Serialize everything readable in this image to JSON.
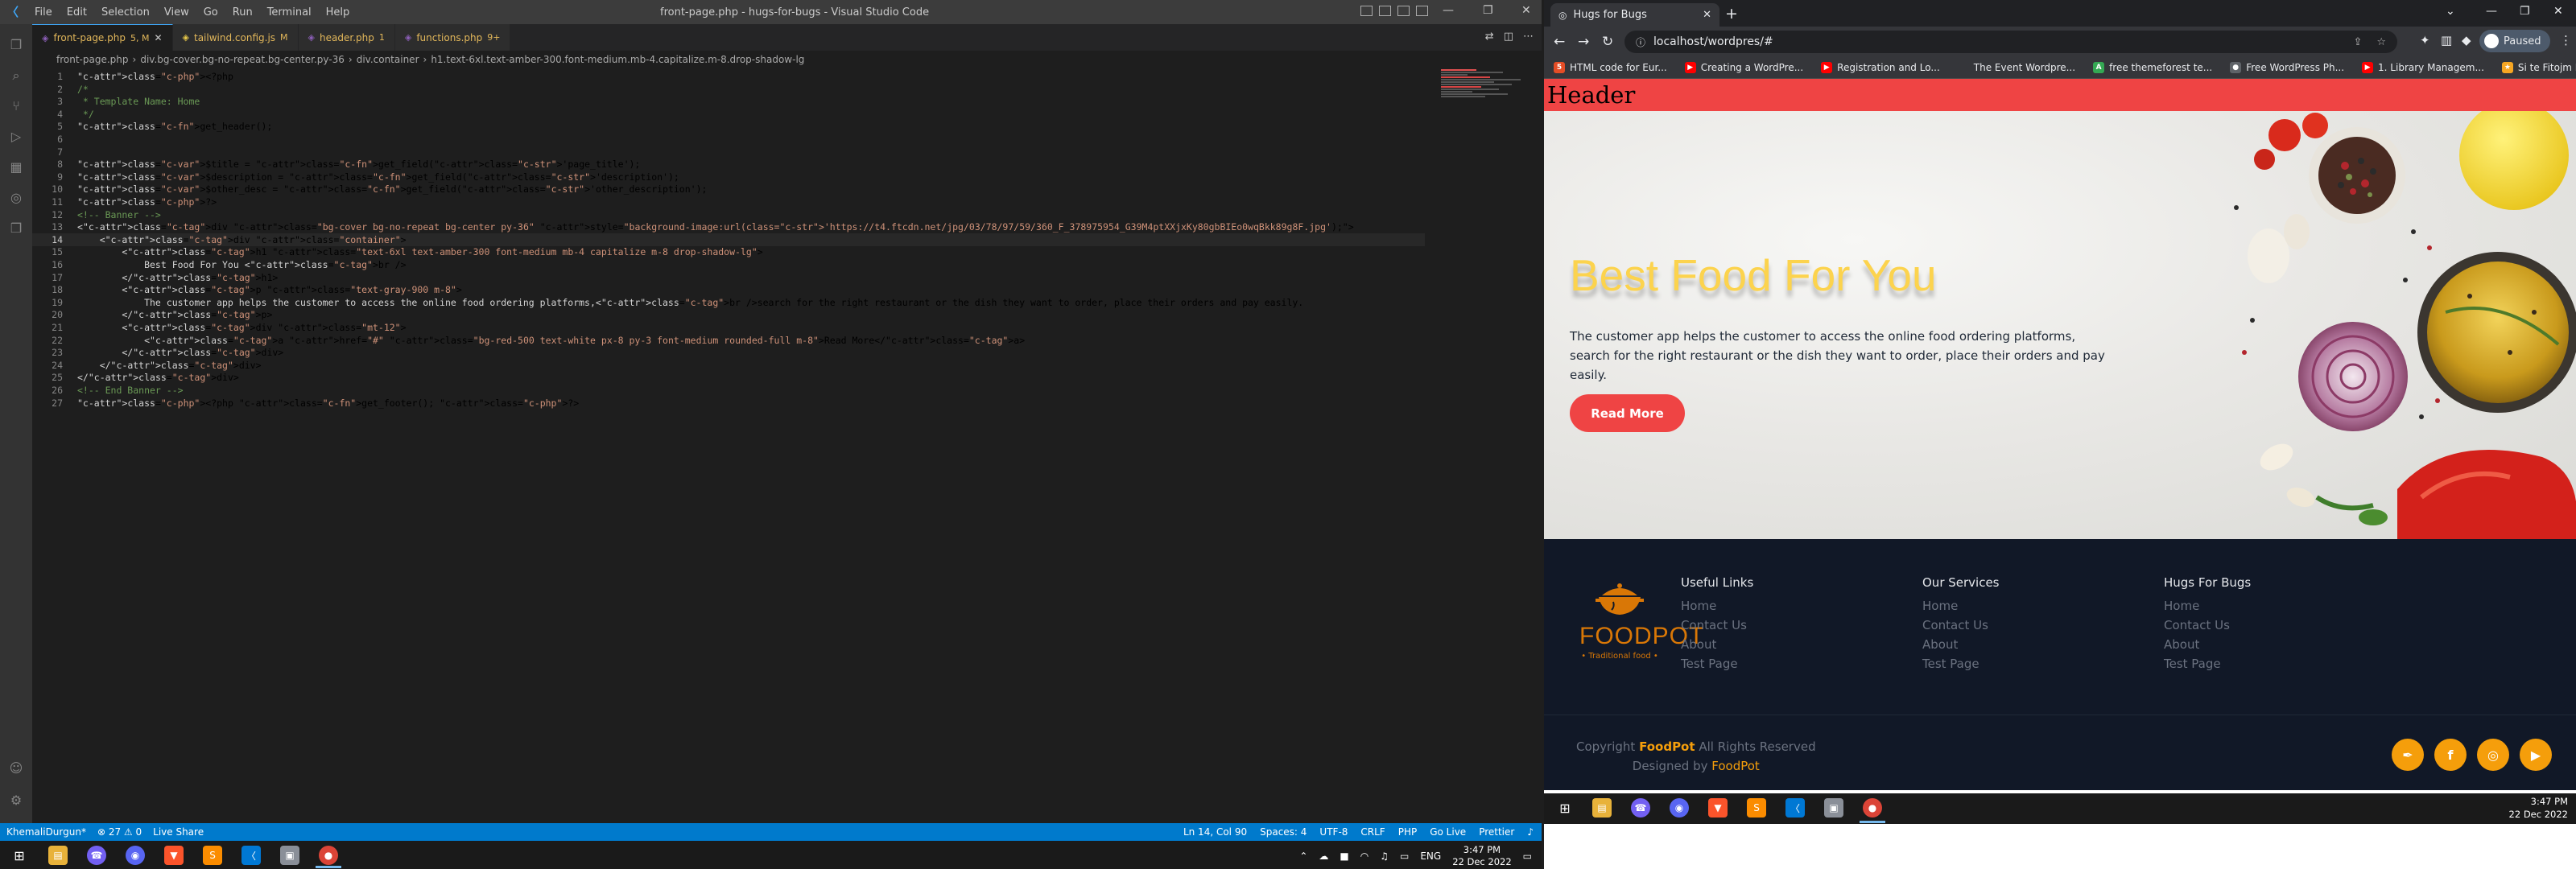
{
  "vscode": {
    "menu": [
      "File",
      "Edit",
      "Selection",
      "View",
      "Go",
      "Run",
      "Terminal",
      "Help"
    ],
    "window_title": "front-page.php - hugs-for-bugs - Visual Studio Code",
    "tabs": [
      {
        "label": "front-page.php",
        "suffix": "5, M",
        "active": true,
        "icon": "php"
      },
      {
        "label": "tailwind.config.js",
        "suffix": "M",
        "active": false,
        "icon": "js"
      },
      {
        "label": "header.php",
        "suffix": "1",
        "active": false,
        "icon": "php"
      },
      {
        "label": "functions.php",
        "suffix": "9+",
        "active": false,
        "icon": "php"
      }
    ],
    "breadcrumb": [
      "front-page.php",
      "div.bg-cover.bg-no-repeat.bg-center.py-36",
      "div.container",
      "h1.text-6xl.text-amber-300.font-medium.mb-4.capitalize.m-8.drop-shadow-lg"
    ],
    "code_lines": [
      "<?php",
      "/*",
      " * Template Name: Home",
      " */",
      "get_header();",
      "",
      "",
      "$title = get_field('page_title');",
      "$description = get_field('description');",
      "$other_desc = get_field('other_description');",
      "?>",
      "<!-- Banner -->",
      "<div class=\"bg-cover bg-no-repeat bg-center py-36\" style=\"background-image:url('https://t4.ftcdn.net/jpg/03/78/97/59/360_F_378975954_G39M4ptXXjxKy80gbBIEo0wqBkk89g8F.jpg');\">",
      "    <div class=\"container\">",
      "        <h1 class=\"text-6xl text-amber-300 font-medium mb-4 capitalize m-8 drop-shadow-lg\">",
      "            Best Food For You <br />",
      "        </h1>",
      "        <p class=\"text-gray-900 m-8\">",
      "            The customer app helps the customer to access the online food ordering platforms,<br />search for the right restaurant or the dish they want to order, place their orders and pay easily.",
      "        </p>",
      "        <div class=\"mt-12\">",
      "            <a href=\"#\" class=\"bg-red-500 text-white px-8 py-3 font-medium rounded-full m-8\">Read More</a>",
      "        </div>",
      "    </div>",
      "</div>",
      "<!-- End Banner -->",
      "<?php get_footer(); ?>"
    ],
    "status": {
      "branch": "KhemaliDurgun*",
      "errors": "⊗ 27 ⚠ 0",
      "live_share": "Live Share",
      "position": "Ln 14, Col 90",
      "spaces": "Spaces: 4",
      "encoding": "UTF-8",
      "eol": "CRLF",
      "language": "PHP",
      "go_live": "Go Live",
      "prettier": "Prettier"
    },
    "taskbar_time": "3:47 PM",
    "taskbar_date": "22 Dec 2022",
    "taskbar_lang": "ENG"
  },
  "chrome": {
    "tab_title": "Hugs for Bugs",
    "url": "localhost/wordpres/#",
    "profile": "Paused",
    "bookmarks": [
      {
        "label": "HTML code for Eur...",
        "color": "#e44d26",
        "icon": "5"
      },
      {
        "label": "Creating a WordPre...",
        "color": "#ff0000",
        "icon": "▶"
      },
      {
        "label": "Registration and Lo...",
        "color": "#ff0000",
        "icon": "▶"
      },
      {
        "label": "The Event Wordpre...",
        "color": "#35363a",
        "icon": ""
      },
      {
        "label": "free themeforest te...",
        "color": "#34a853",
        "icon": "A"
      },
      {
        "label": "Free WordPress Ph...",
        "color": "#5f6368",
        "icon": "●"
      },
      {
        "label": "1. Library Managem...",
        "color": "#ff0000",
        "icon": "▶"
      },
      {
        "label": "Si te Fitojm Para...",
        "color": "#f6a623",
        "icon": "★"
      }
    ],
    "page": {
      "header": "Header",
      "banner_title": "Best Food For You",
      "banner_desc_1": "The customer app helps the customer to access the online food ordering platforms,",
      "banner_desc_2": "search for the right restaurant or the dish they want to order, place their orders and pay easily.",
      "read_more": "Read More",
      "footer_brand": "FOODPOT",
      "footer_tagline": "• Traditional food •",
      "columns": [
        {
          "title": "Useful Links",
          "links": [
            "Home",
            "Contact Us",
            "About",
            "Test Page"
          ]
        },
        {
          "title": "Our Services",
          "links": [
            "Home",
            "Contact Us",
            "About",
            "Test Page"
          ]
        },
        {
          "title": "Hugs For Bugs",
          "links": [
            "Home",
            "Contact Us",
            "About",
            "Test Page"
          ]
        }
      ],
      "copyright_prefix": "Copyright",
      "copyright_brand": "FoodPot",
      "copyright_suffix": "All Rights Reserved",
      "designed_prefix": "Designed by",
      "designed_brand": "FoodPot"
    },
    "taskbar_time": "3:47 PM",
    "taskbar_date": "22 Dec 2022"
  }
}
